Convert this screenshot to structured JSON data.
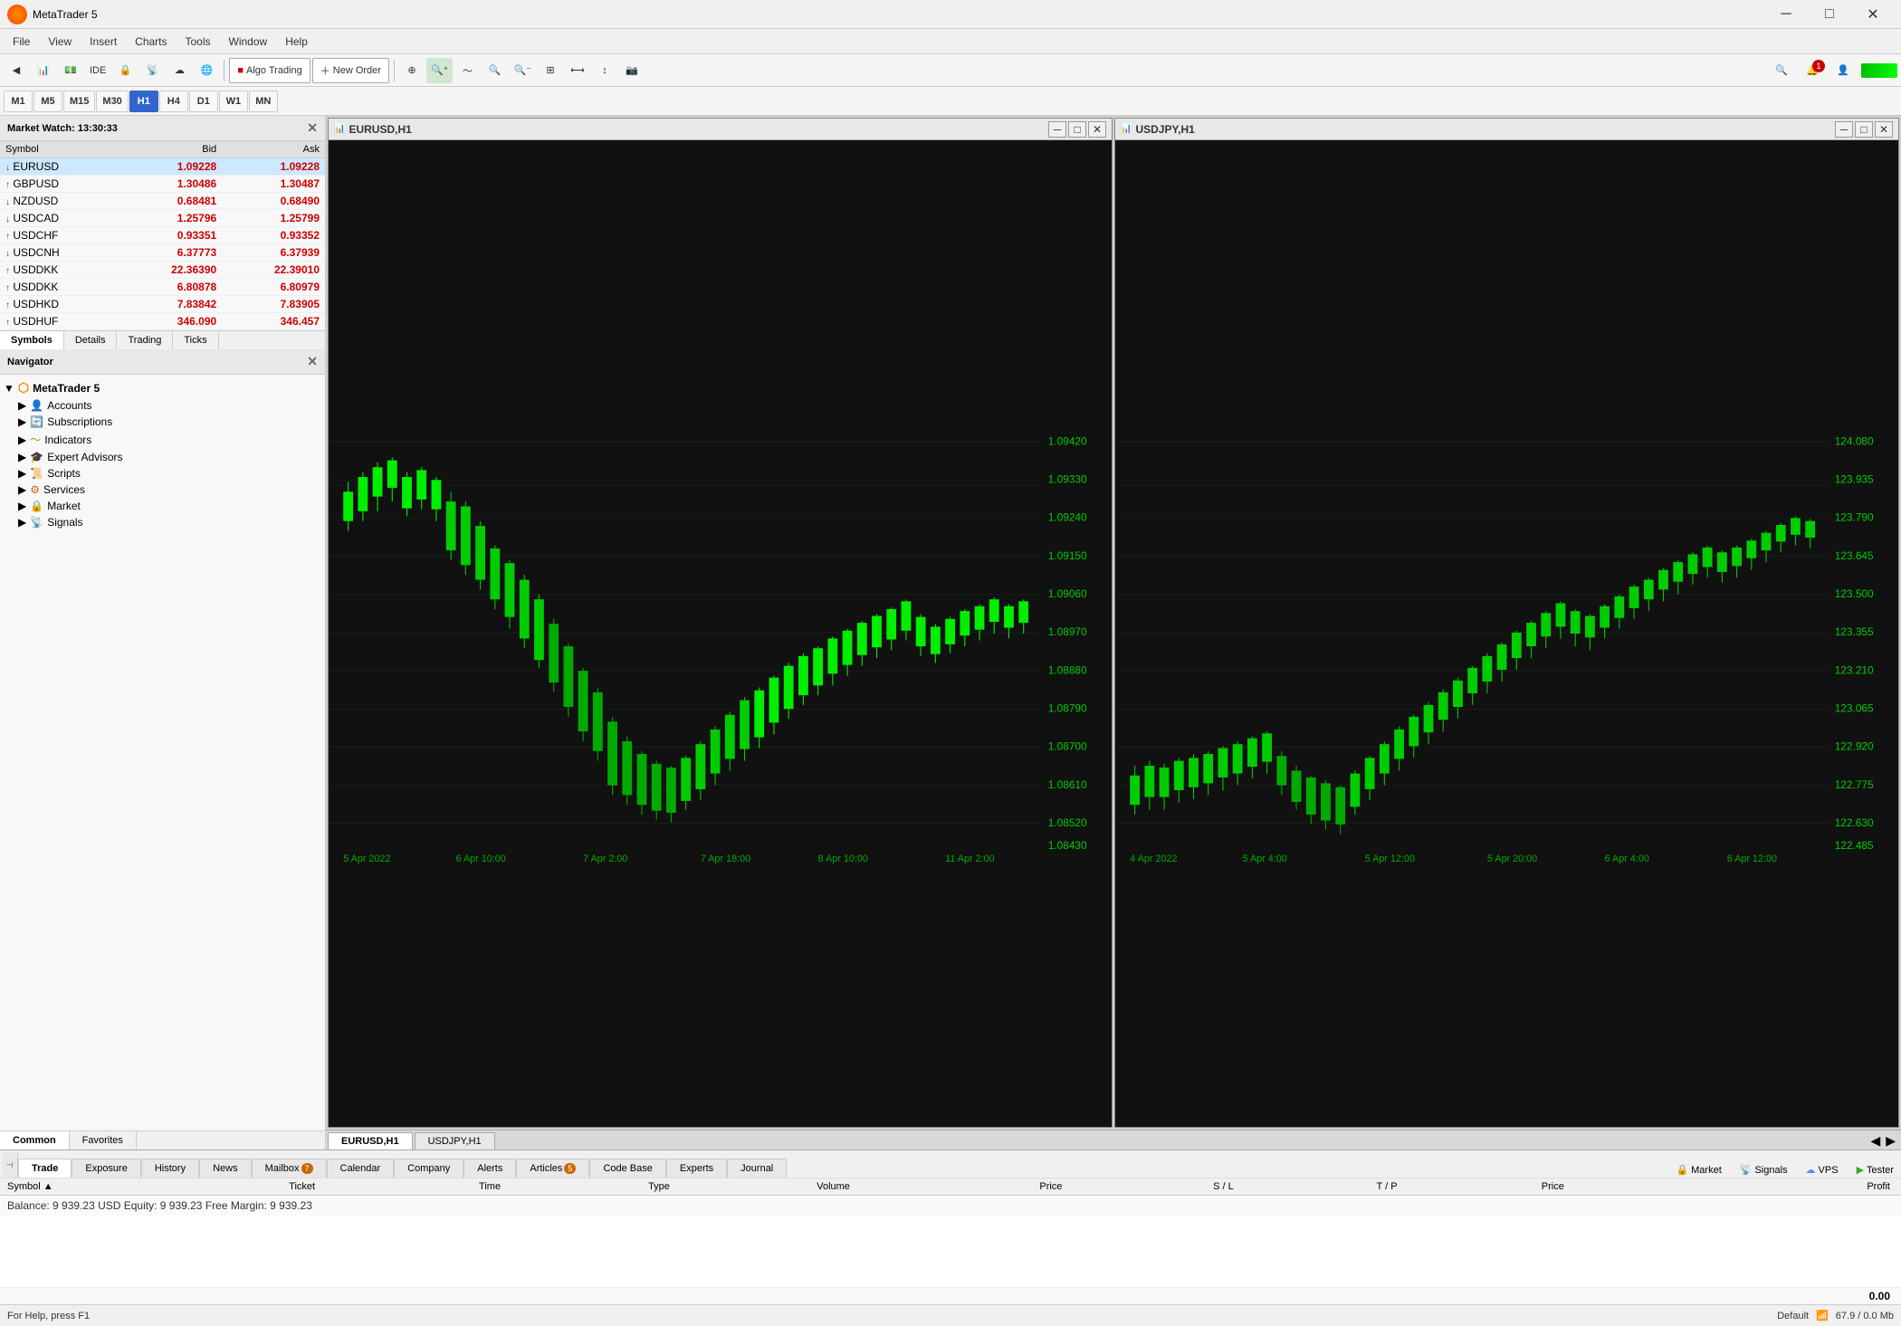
{
  "titlebar": {
    "title": "MetaTrader 5",
    "min": "─",
    "max": "□",
    "close": "✕"
  },
  "menu": {
    "items": [
      "File",
      "View",
      "Insert",
      "Charts",
      "Tools",
      "Window",
      "Help"
    ]
  },
  "toolbar": {
    "algo_trading": "Algo Trading",
    "new_order": "New Order",
    "timeframes": [
      "M1",
      "M5",
      "M15",
      "M30",
      "H1",
      "H4",
      "D1",
      "W1",
      "MN"
    ],
    "active_tf": "H1"
  },
  "market_watch": {
    "title": "Market Watch: 13:30:33",
    "columns": [
      "Symbol",
      "Bid",
      "Ask"
    ],
    "symbols": [
      {
        "name": "EURUSD",
        "bid": "1.09228",
        "ask": "1.09228",
        "dir": "down",
        "selected": true
      },
      {
        "name": "GBPUSD",
        "bid": "1.30486",
        "ask": "1.30487",
        "dir": "up"
      },
      {
        "name": "NZDUSD",
        "bid": "0.68481",
        "ask": "0.68490",
        "dir": "down"
      },
      {
        "name": "USDCAD",
        "bid": "1.25796",
        "ask": "1.25799",
        "dir": "down"
      },
      {
        "name": "USDCHF",
        "bid": "0.93351",
        "ask": "0.93352",
        "dir": "up"
      },
      {
        "name": "USDCNH",
        "bid": "6.37773",
        "ask": "6.37939",
        "dir": "down"
      },
      {
        "name": "USDDKK",
        "bid": "22.36390",
        "ask": "22.39010",
        "dir": "up"
      },
      {
        "name": "USDDKK",
        "bid": "6.80878",
        "ask": "6.80979",
        "dir": "up"
      },
      {
        "name": "USDHKD",
        "bid": "7.83842",
        "ask": "7.83905",
        "dir": "up"
      },
      {
        "name": "USDHUF",
        "bid": "346.090",
        "ask": "346.457",
        "dir": "up"
      }
    ],
    "tabs": [
      "Symbols",
      "Details",
      "Trading",
      "Ticks"
    ]
  },
  "navigator": {
    "title": "Navigator",
    "items": [
      {
        "label": "MetaTrader 5",
        "level": 0,
        "icon": "mt5"
      },
      {
        "label": "Accounts",
        "level": 1,
        "icon": "accounts"
      },
      {
        "label": "Subscriptions",
        "level": 1,
        "icon": "subscriptions"
      },
      {
        "label": "Indicators",
        "level": 1,
        "icon": "indicators"
      },
      {
        "label": "Expert Advisors",
        "level": 1,
        "icon": "experts"
      },
      {
        "label": "Scripts",
        "level": 1,
        "icon": "scripts"
      },
      {
        "label": "Services",
        "level": 1,
        "icon": "services"
      },
      {
        "label": "Market",
        "level": 1,
        "icon": "market"
      },
      {
        "label": "Signals",
        "level": 1,
        "icon": "signals"
      }
    ],
    "tabs": [
      "Common",
      "Favorites"
    ]
  },
  "charts": [
    {
      "id": "chart1",
      "title": "EURUSD,H1",
      "tab": "EURUSD,H1",
      "price_levels": [
        "1.09420",
        "1.09330",
        "1.09240",
        "1.09150",
        "1.09060",
        "1.08970",
        "1.08880",
        "1.08790",
        "1.08700",
        "1.08610",
        "1.08520",
        "1.08430"
      ],
      "time_labels": [
        "5 Apr 2022",
        "6 Apr 10:00",
        "7 Apr 2:00",
        "7 Apr 18:00",
        "8 Apr 10:00",
        "11 Apr 2:00"
      ]
    },
    {
      "id": "chart2",
      "title": "USDJPY,H1",
      "tab": "USDJPY,H1",
      "price_levels": [
        "124.080",
        "123.935",
        "123.790",
        "123.645",
        "123.500",
        "123.355",
        "123.210",
        "123.065",
        "122.920",
        "122.775",
        "122.630",
        "122.485"
      ],
      "time_labels": [
        "4 Apr 2022",
        "5 Apr 4:00",
        "5 Apr 12:00",
        "5 Apr 20:00",
        "6 Apr 4:00",
        "6 Apr 12:00"
      ]
    }
  ],
  "terminal": {
    "columns": [
      "Symbol",
      "Ticket",
      "Time",
      "Type",
      "Volume",
      "Price",
      "S / L",
      "T / P",
      "Price",
      "Profit"
    ],
    "balance_text": "Balance: 9 939.23 USD  Equity: 9 939.23  Free Margin: 9 939.23",
    "profit_value": "0.00",
    "tabs": [
      "Trade",
      "Exposure",
      "History",
      "News",
      "Mailbox",
      "Calendar",
      "Company",
      "Alerts",
      "Articles",
      "Code Base",
      "Experts",
      "Journal"
    ],
    "mailbox_badge": "7",
    "articles_badge": "5",
    "active_tab": "Trade"
  },
  "bottom_bar": {
    "market_label": "Market",
    "signals_label": "Signals",
    "vps_label": "VPS",
    "tester_label": "Tester",
    "zoom": "67.9 / 0.0 Mb"
  },
  "status_bar": {
    "help_text": "For Help, press F1",
    "profile": "Default"
  }
}
